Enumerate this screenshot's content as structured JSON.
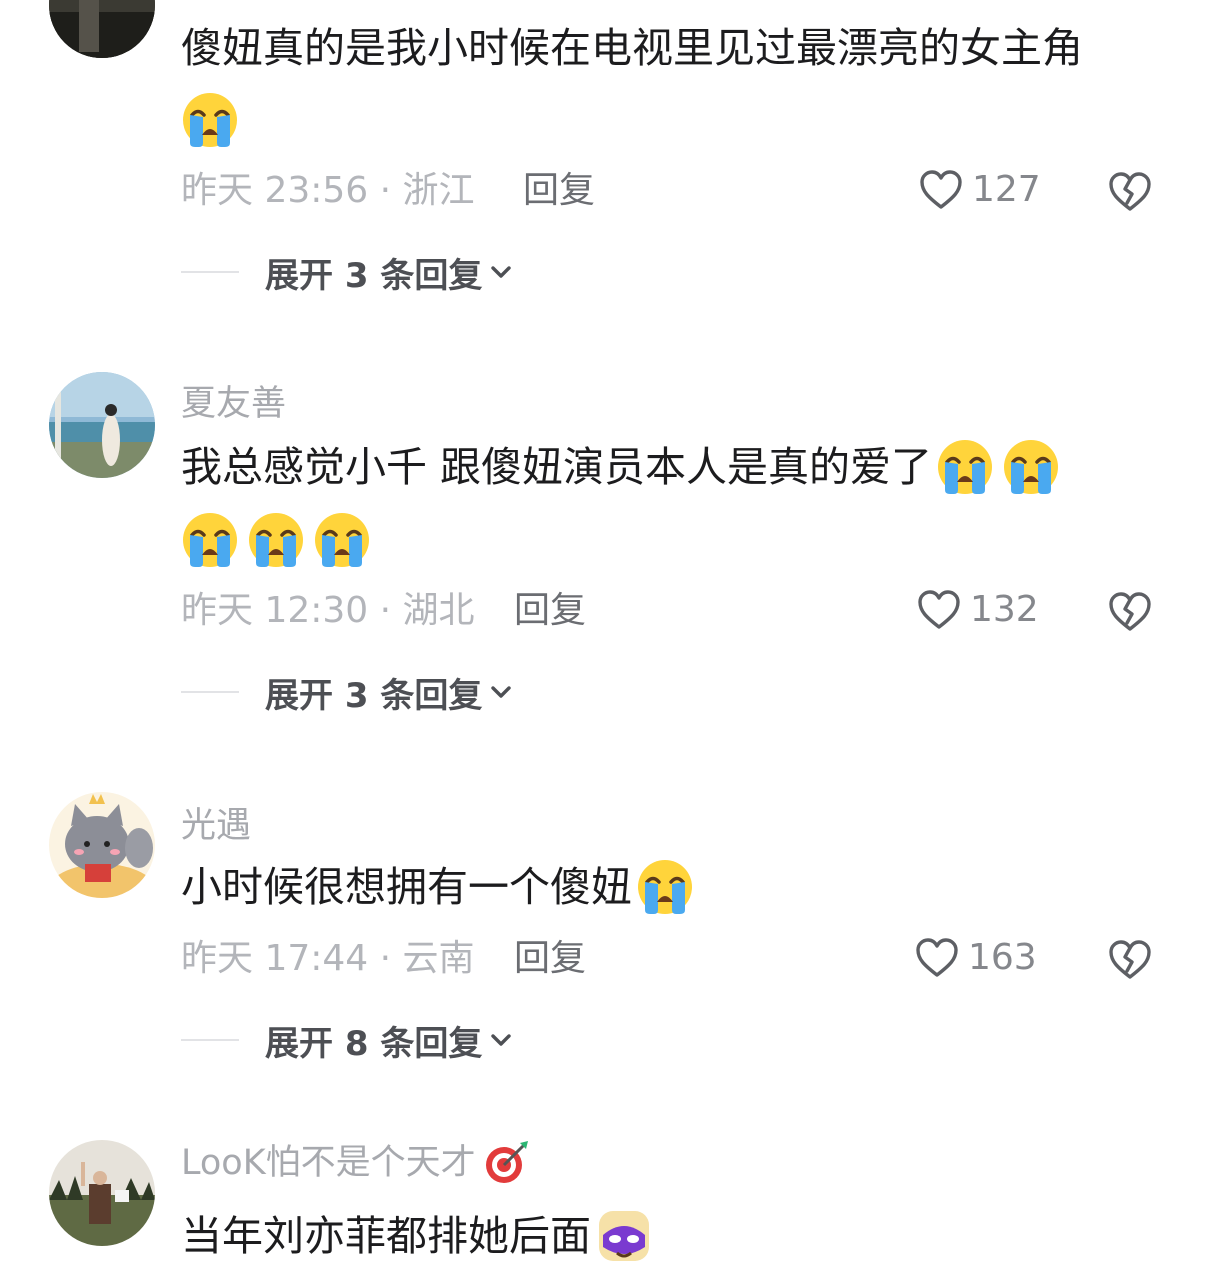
{
  "comments": [
    {
      "username": "",
      "line1": "傻妞真的是我小时候在电视里见过最漂亮的女主角",
      "line2": "",
      "time": "昨天 23:56 · 浙江",
      "reply": "回复",
      "likes": "127",
      "expand": "展开 3 条回复"
    },
    {
      "username": "夏友善",
      "line1": "我总感觉小千 跟傻妞演员本人是真的爱了",
      "line2": "",
      "time": "昨天 12:30 · 湖北",
      "reply": "回复",
      "likes": "132",
      "expand": "展开 3 条回复"
    },
    {
      "username": "光遇",
      "line1": "小时候很想拥有一个傻妞",
      "line2": "",
      "time": "昨天 17:44 · 云南",
      "reply": "回复",
      "likes": "163",
      "expand": "展开 8 条回复"
    },
    {
      "username": "LooK怕不是个天才",
      "line1": "当年刘亦菲都排她后面",
      "line2": "",
      "time": "",
      "reply": "",
      "likes": "",
      "expand": ""
    }
  ],
  "icons": {
    "emoji_crying": "loudly-crying-face-icon",
    "emoji_target": "direct-hit-icon",
    "emoji_mask": "mask-face-icon",
    "like": "heart-outline-icon",
    "dislike": "broken-heart-icon",
    "chevron": "chevron-down-icon"
  },
  "colors": {
    "text": "#1c1c1e",
    "muted": "#b3b5ba",
    "username": "#a7a9ae",
    "reply": "#6b6d72"
  }
}
